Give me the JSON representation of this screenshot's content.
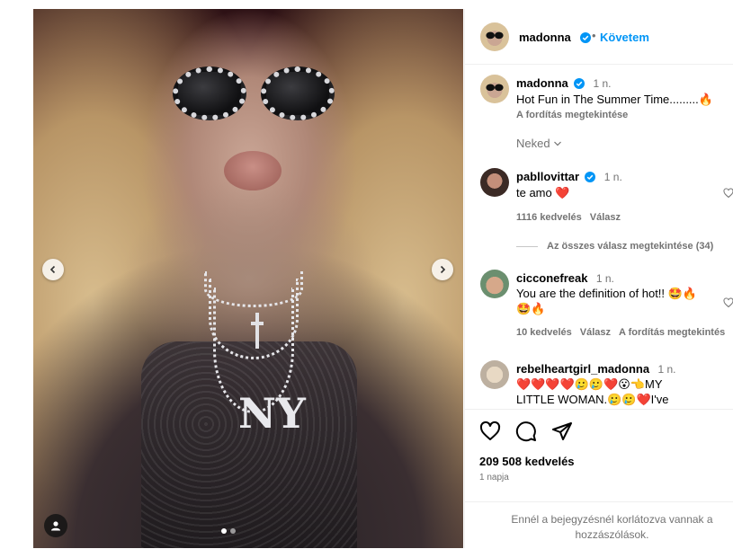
{
  "post": {
    "author": "madonna",
    "follow_label": "Követem",
    "separator": "•",
    "carousel": {
      "slide_count": 2,
      "active_index": 0
    }
  },
  "caption": {
    "username": "madonna",
    "time": "1 n.",
    "text": "Hot Fun in The Summer Time.........",
    "emoji": "🔥",
    "see_translation": "A fordítás megtekintése"
  },
  "sort": {
    "label": "Neked"
  },
  "comments": [
    {
      "username": "pabllovittar",
      "verified": true,
      "time": "1 n.",
      "text": "te amo ",
      "emoji": "❤️",
      "likes": "1116 kedvelés",
      "reply": "Válasz",
      "view_replies": "Az összes válasz megtekintése (34)"
    },
    {
      "username": "cicconefreak",
      "verified": false,
      "time": "1 n.",
      "text_line1": "You are the definition of hot!! 🤩🔥",
      "text_line2": "🤩🔥",
      "likes": "10 kedvelés",
      "reply": "Válasz",
      "see_translation": "A fordítás megtekintés"
    },
    {
      "username": "rebelheartgirl_madonna",
      "verified": false,
      "time": "1 n.",
      "text_line1": "❤️❤️❤️❤️🥲🥲❤️😮👈MY",
      "text_line2": "LITTLE WOMAN.🥲🥲❤️I've"
    }
  ],
  "actions": {
    "likes": "209 508 kedvelés",
    "age": "1 napja",
    "icons": [
      "heart-icon",
      "comment-icon",
      "share-icon"
    ]
  },
  "restricted": {
    "line1": "Ennél a bejegyzésnél korlátozva vannak a",
    "line2": "hozzászólások."
  },
  "colors": {
    "link_blue": "#0095f6",
    "muted": "#737373",
    "heart_red": "#ed4956"
  }
}
